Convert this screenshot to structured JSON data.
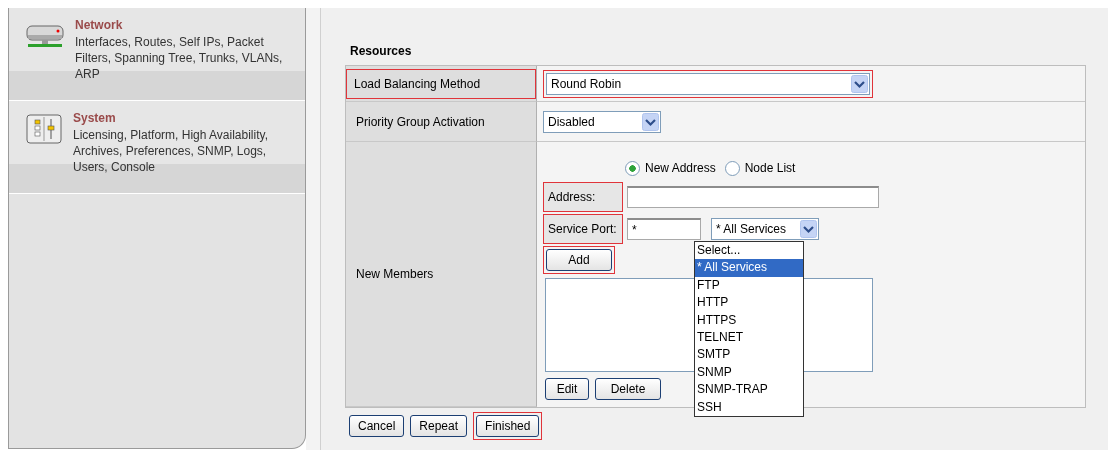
{
  "sidebar": {
    "items": [
      {
        "kind": "network",
        "title": "Network",
        "description": "Interfaces, Routes, Self IPs, Packet Filters, Spanning Tree, Trunks, VLANs, ARP"
      },
      {
        "kind": "system",
        "title": "System",
        "description": "Licensing, Platform, High Availability, Archives, Preferences, SNMP, Logs, Users, Console"
      }
    ]
  },
  "section_title": "Resources",
  "load_balancing": {
    "label": "Load Balancing Method",
    "value": "Round Robin",
    "highlighted": true
  },
  "priority_group": {
    "label": "Priority Group Activation",
    "value": "Disabled"
  },
  "new_members": {
    "label": "New Members",
    "address_type": [
      {
        "label": "New Address",
        "selected": true
      },
      {
        "label": "Node List",
        "selected": false
      }
    ],
    "address": {
      "label": "Address:",
      "highlighted": true
    },
    "service_port": {
      "label": "Service Port:",
      "value": "*",
      "highlighted": true
    },
    "service": {
      "value": "* All Services",
      "expanded": true,
      "options": [
        {
          "label": "Select...",
          "selected": false
        },
        {
          "label": "* All Services",
          "selected": true
        },
        {
          "label": "FTP",
          "selected": false
        },
        {
          "label": "HTTP",
          "selected": false
        },
        {
          "label": "HTTPS",
          "selected": false
        },
        {
          "label": "TELNET",
          "selected": false
        },
        {
          "label": "SMTP",
          "selected": false
        },
        {
          "label": "SNMP",
          "selected": false
        },
        {
          "label": "SNMP-TRAP",
          "selected": false
        },
        {
          "label": "SSH",
          "selected": false
        }
      ]
    },
    "add_button": {
      "label": "Add",
      "highlighted": true
    },
    "list_buttons": [
      {
        "label": "Edit"
      },
      {
        "label": "Delete"
      }
    ]
  },
  "footer_buttons": [
    {
      "label": "Cancel",
      "highlighted": false
    },
    {
      "label": "Repeat",
      "highlighted": false
    },
    {
      "label": "Finished",
      "highlighted": true
    }
  ]
}
